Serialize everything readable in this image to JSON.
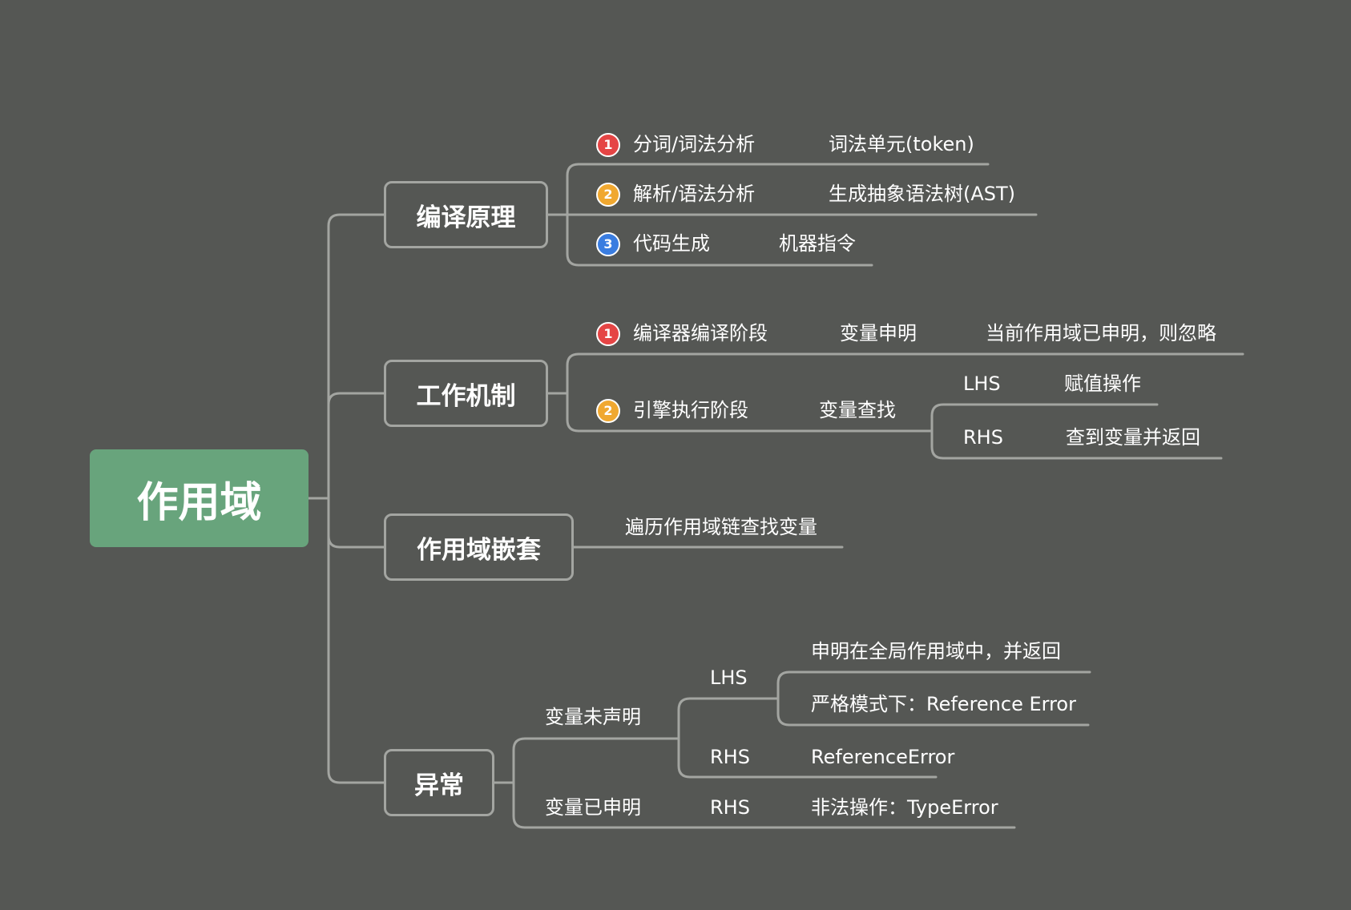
{
  "root": "作用域",
  "branches": {
    "compile": {
      "title": "编译原理",
      "items": [
        {
          "badge": "1",
          "label": "分词/词法分析",
          "detail": "词法单元(token)"
        },
        {
          "badge": "2",
          "label": "解析/语法分析",
          "detail": "生成抽象语法树(AST)"
        },
        {
          "badge": "3",
          "label": "代码生成",
          "detail": "机器指令"
        }
      ]
    },
    "mechanism": {
      "title": "工作机制",
      "compiler": {
        "badge": "1",
        "label": "编译器编译阶段",
        "step": "变量申明",
        "detail": "当前作用域已申明，则忽略"
      },
      "engine": {
        "badge": "2",
        "label": "引擎执行阶段",
        "step": "变量查找",
        "lhs": {
          "label": "LHS",
          "detail": "赋值操作"
        },
        "rhs": {
          "label": "RHS",
          "detail": "查到变量并返回"
        }
      }
    },
    "nesting": {
      "title": "作用域嵌套",
      "detail": "遍历作用域链查找变量"
    },
    "errors": {
      "title": "异常",
      "undeclared": {
        "label": "变量未声明",
        "lhs": {
          "label": "LHS",
          "items": [
            "申明在全局作用域中，并返回",
            "严格模式下：Reference Error"
          ]
        },
        "rhs": {
          "label": "RHS",
          "detail": "ReferenceError"
        }
      },
      "declared": {
        "label": "变量已申明",
        "rhs": {
          "label": "RHS",
          "detail": "非法操作：TypeError"
        }
      }
    }
  },
  "colors": {
    "background": "#555754",
    "root": "#68a47c",
    "line": "#a3a5a1",
    "badge1": "#e54545",
    "badge2": "#f0a830",
    "badge3": "#3a7de0"
  }
}
